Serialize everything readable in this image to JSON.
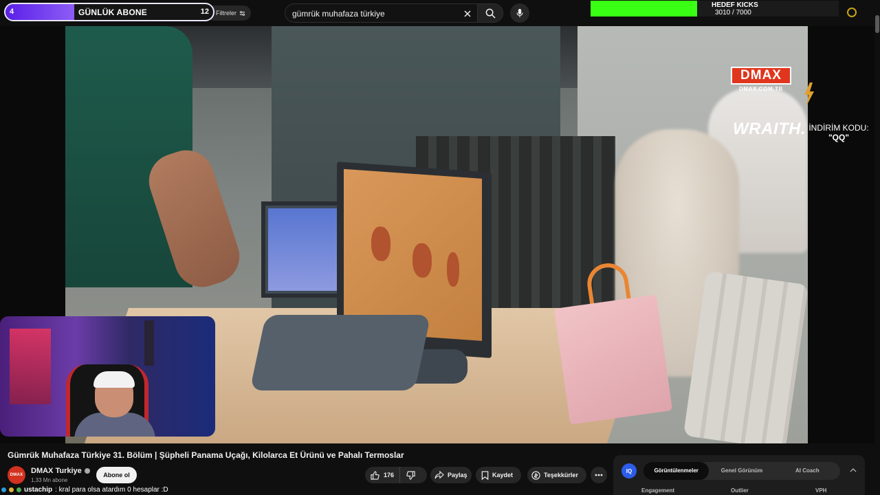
{
  "sub_goal": {
    "left_number": "4",
    "title": "GÜNLÜK ABONE",
    "right_number": "12",
    "progress": 0.33
  },
  "filters": {
    "label": "Filtreler"
  },
  "search": {
    "query": "gümrük muhafaza türkiye"
  },
  "kicks_goal": {
    "label": "HEDEF KICKS",
    "count": "3010 / 7000",
    "progress": 0.43
  },
  "overlay": {
    "dmax_logo": "DMAX",
    "dmax_url": "DMAX.COM.TR",
    "sponsor": "WRAITH.",
    "promo_label": "İNDİRİM KODU:",
    "promo_code": "\"QQ\""
  },
  "video": {
    "title": "Gümrük Muhafaza Türkiye 31. Bölüm | Şüpheli Panama Uçağı, Kilolarca Et Ürünü ve Pahalı Termoslar",
    "channel_avatar_text": "DMAX",
    "channel_name": "DMAX Turkiye",
    "subscribers": "1,33 Mn abone",
    "subscribe_label": "Abone ol"
  },
  "actions": {
    "likes": "176",
    "share": "Paylaş",
    "save": "Kaydet",
    "thanks": "Teşekkürler"
  },
  "chat": {
    "user": "ustachip",
    "message": ": kral para olsa atardım 0 hesaplar :D"
  },
  "analytics": {
    "logo": "IQ",
    "tabs": [
      {
        "label": "Görüntülenmeler",
        "active": true
      },
      {
        "label": "Genel Görünüm",
        "active": false
      },
      {
        "label": "AI Coach",
        "active": false
      }
    ],
    "metrics": [
      "Engagement",
      "Outlier",
      "VPH"
    ]
  },
  "colors": {
    "kicks_green": "#39ff14",
    "sub_purple": "#6a2cf0",
    "dmax_red": "#e0361d",
    "iq_blue": "#2d5de8"
  }
}
